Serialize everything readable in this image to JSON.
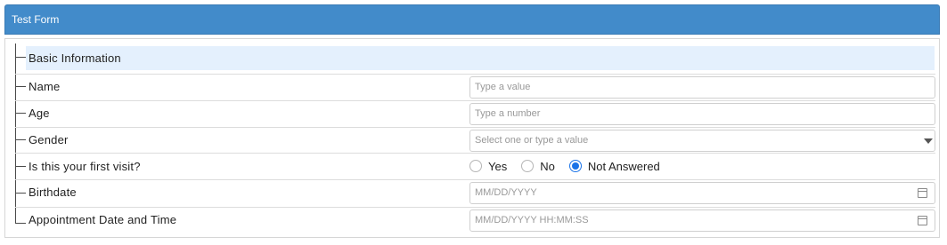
{
  "form": {
    "title": "Test Form",
    "section_title": "Basic Information",
    "fields": [
      {
        "label": "Name",
        "placeholder": "Type a value"
      },
      {
        "label": "Age",
        "placeholder": "Type a number"
      },
      {
        "label": "Gender",
        "placeholder": "Select one or type a value"
      },
      {
        "label": "Is this your first visit?",
        "options": [
          "Yes",
          "No",
          "Not Answered"
        ],
        "selected": "Not Answered"
      },
      {
        "label": "Birthdate",
        "placeholder": "MM/DD/YYYY"
      },
      {
        "label": "Appointment Date and Time",
        "placeholder": "MM/DD/YYYY HH:MM:SS"
      }
    ]
  },
  "icons": {
    "dropdown": "chevron-down-icon",
    "date": "calendar-icon",
    "datetime": "calendar-icon"
  },
  "colors": {
    "header_bg": "#428bca",
    "section_bg": "#e4f0fd",
    "radio_selected": "#1a73e8"
  }
}
